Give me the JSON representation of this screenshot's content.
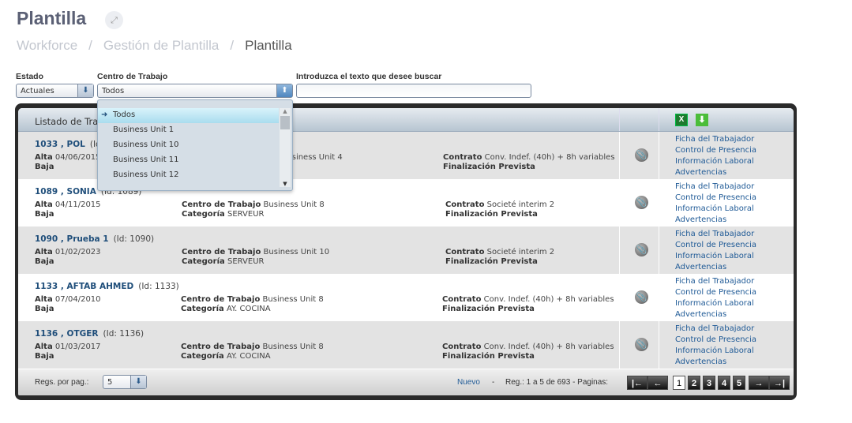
{
  "page": {
    "title": "Plantilla",
    "expand_icon": "expand-arrows-icon"
  },
  "breadcrumb": [
    "Workforce",
    "/",
    "Gestión de Plantilla",
    "/",
    "Plantilla"
  ],
  "filters": {
    "estado": {
      "label": "Estado",
      "value": "Actuales"
    },
    "centro": {
      "label": "Centro de Trabajo",
      "value": "Todos",
      "options": [
        "Todos",
        "Business Unit 1",
        "Business Unit 10",
        "Business Unit 11",
        "Business Unit 12"
      ]
    },
    "search": {
      "label": "Introduzca el texto que desee buscar",
      "value": ""
    }
  },
  "list": {
    "header": "Listado de Trabajadores",
    "labels": {
      "alta": "Alta",
      "baja": "Baja",
      "centro": "Centro de Trabajo",
      "categoria": "Categoría",
      "contrato": "Contrato",
      "fin": "Finalización Prevista"
    },
    "links": [
      "Ficha del Trabajador",
      "Control de Presencia",
      "Información Laboral",
      "Advertencias"
    ],
    "rows": [
      {
        "name": "1033 , POL",
        "id": "(Id: 1033)",
        "alta": "04/06/2015",
        "centro": "Business Unit 4",
        "categoria": "",
        "contrato": "Conv. Indef. (40h) + 8h variables"
      },
      {
        "name": "1089 , SONIA",
        "id": "(Id: 1089)",
        "alta": "04/11/2015",
        "centro": "Business Unit 8",
        "categoria": "SERVEUR",
        "contrato": "Societé interim 2"
      },
      {
        "name": "1090 , Prueba 1",
        "id": "(Id: 1090)",
        "alta": "01/02/2023",
        "centro": "Business Unit 10",
        "categoria": "SERVEUR",
        "contrato": "Societé interim 2"
      },
      {
        "name": "1133 , AFTAB AHMED",
        "id": "(Id: 1133)",
        "alta": "07/04/2010",
        "centro": "Business Unit 8",
        "categoria": "AY. COCINA",
        "contrato": "Conv. Indef. (40h) + 8h variables"
      },
      {
        "name": "1136 , OTGER",
        "id": "(Id: 1136)",
        "alta": "01/03/2017",
        "centro": "Business Unit 8",
        "categoria": "AY. COCINA",
        "contrato": "Conv. Indef. (40h) + 8h variables"
      }
    ]
  },
  "footer": {
    "per_page_label": "Regs. por pag.:",
    "per_page": "5",
    "nuevo": "Nuevo",
    "dash": "-",
    "regs": "Reg.: 1 a 5 de 693 - Paginas:",
    "pages": [
      "1",
      "2",
      "3",
      "4",
      "5"
    ],
    "current_page": "1"
  }
}
